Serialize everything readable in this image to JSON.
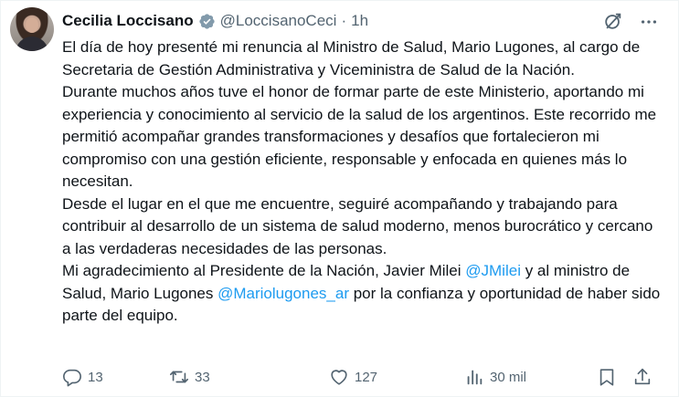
{
  "author": {
    "name": "Cecilia Loccisano",
    "handle": "@LoccisanoCeci",
    "separator": "·",
    "time": "1h"
  },
  "tweet": {
    "p1": "El día de hoy presenté mi renuncia al Ministro de Salud, Mario Lugones, al cargo de Secretaria de Gestión Administrativa y Viceministra de Salud de la Nación.",
    "p2": "Durante muchos años tuve el honor de formar parte de este Ministerio, aportando mi experiencia y conocimiento al servicio de la salud de los argentinos. Este recorrido me permitió acompañar grandes transformaciones y desafíos que fortalecieron mi compromiso con una gestión eficiente, responsable y enfocada en quienes más lo necesitan.",
    "p3": "Desde el lugar en el que me encuentre, seguiré acompañando y trabajando para contribuir al desarrollo de un sistema de salud moderno, menos burocrático y cercano a las verdaderas necesidades de las personas.",
    "p4_a": "Mi agradecimiento al Presidente de la Nación, Javier Milei ",
    "mention1": "@JMilei",
    "p4_b": " y al ministro de Salud, Mario Lugones ",
    "mention2": "@Mariolugones_ar",
    "p4_c": " por la confianza y oportunidad de haber sido parte del equipo."
  },
  "actions": {
    "replies": "13",
    "retweets": "33",
    "likes": "127",
    "views": "30 mil"
  },
  "colors": {
    "accent": "#1d9bf0",
    "muted": "#536471",
    "text": "#0f1419"
  },
  "icons": [
    "verified-badge-icon",
    "grok-icon",
    "more-icon",
    "reply-icon",
    "retweet-icon",
    "like-icon",
    "views-icon",
    "bookmark-icon",
    "share-icon"
  ]
}
